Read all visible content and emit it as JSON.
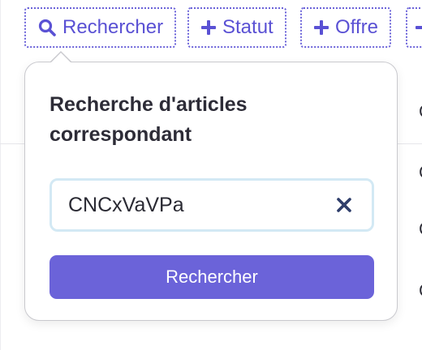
{
  "filters": {
    "search_label": "Rechercher",
    "status_label": "Statut",
    "offer_label": "Offre"
  },
  "popover": {
    "title": "Recherche d'articles correspondant",
    "input_value": "CNCxVaVPa",
    "submit_label": "Rechercher"
  },
  "icons": {
    "search": "search-icon",
    "plus": "plus-icon",
    "clear": "close-icon"
  },
  "colors": {
    "accent": "#6b63d9",
    "title_text": "#2d2c37",
    "input_border": "#d3e9f4"
  }
}
